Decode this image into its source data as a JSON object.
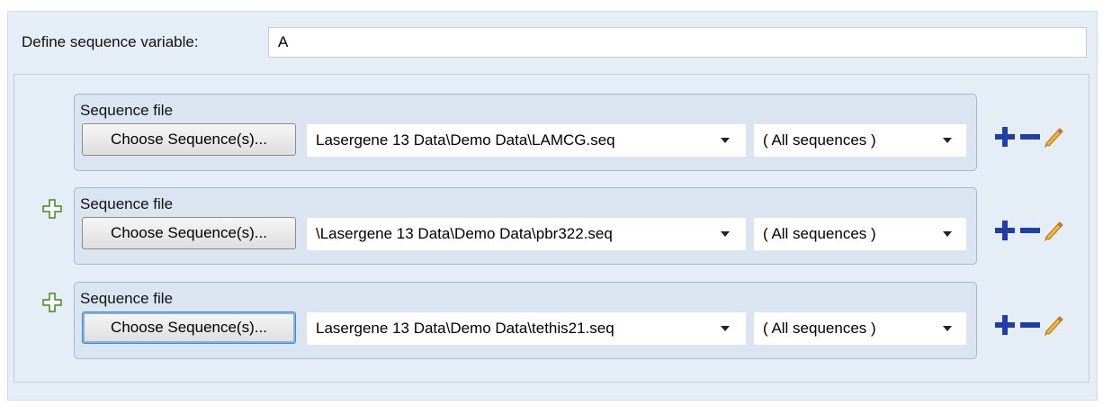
{
  "define": {
    "label": "Define sequence variable:",
    "value": "A"
  },
  "rows": [
    {
      "label": "Sequence file",
      "choose_button": "Choose Sequence(s)...",
      "file_path": "Lasergene 13 Data\\Demo Data\\LAMCG.seq",
      "sequence_filter": "( All sequences )",
      "has_insert_icon": false,
      "focused": false
    },
    {
      "label": "Sequence file",
      "choose_button": "Choose Sequence(s)...",
      "file_path": "\\Lasergene 13 Data\\Demo Data\\pbr322.seq",
      "sequence_filter": "( All sequences )",
      "has_insert_icon": true,
      "focused": false
    },
    {
      "label": "Sequence file",
      "choose_button": "Choose Sequence(s)...",
      "file_path": "Lasergene 13 Data\\Demo Data\\tethis21.seq",
      "sequence_filter": "( All sequences )",
      "has_insert_icon": true,
      "focused": true
    }
  ],
  "icons": {
    "add": "plus-icon",
    "remove": "minus-icon",
    "edit": "pencil-icon",
    "insert": "plus-outline-icon"
  },
  "colors": {
    "panel_bg": "#e5edf7",
    "row_bg": "#dbe5f1",
    "icon_blue": "#1f3fa6",
    "insert_green": "#3c8c1e",
    "pencil_orange": "#e8a21a"
  }
}
